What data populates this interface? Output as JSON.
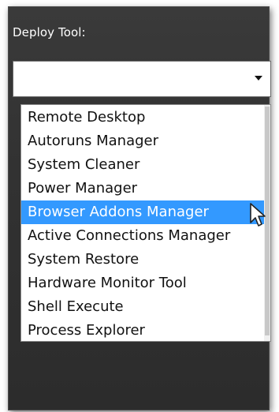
{
  "deploy": {
    "label": "Deploy Tool:",
    "selected_value": "",
    "options": [
      "Remote Desktop",
      "Autoruns Manager",
      "System Cleaner",
      "Power Manager",
      "Browser Addons Manager",
      "Active Connections Manager",
      "System Restore",
      "Hardware Monitor Tool",
      "Shell Execute",
      "Process Explorer"
    ],
    "highlighted_index": 4
  },
  "icons": {
    "dropdown_arrow": "chevron-down-icon",
    "cursor": "mouse-pointer-icon"
  },
  "colors": {
    "panel_bg": "#333333",
    "highlight": "#3399ff",
    "text": "#111111",
    "label_text": "#ffffff"
  }
}
